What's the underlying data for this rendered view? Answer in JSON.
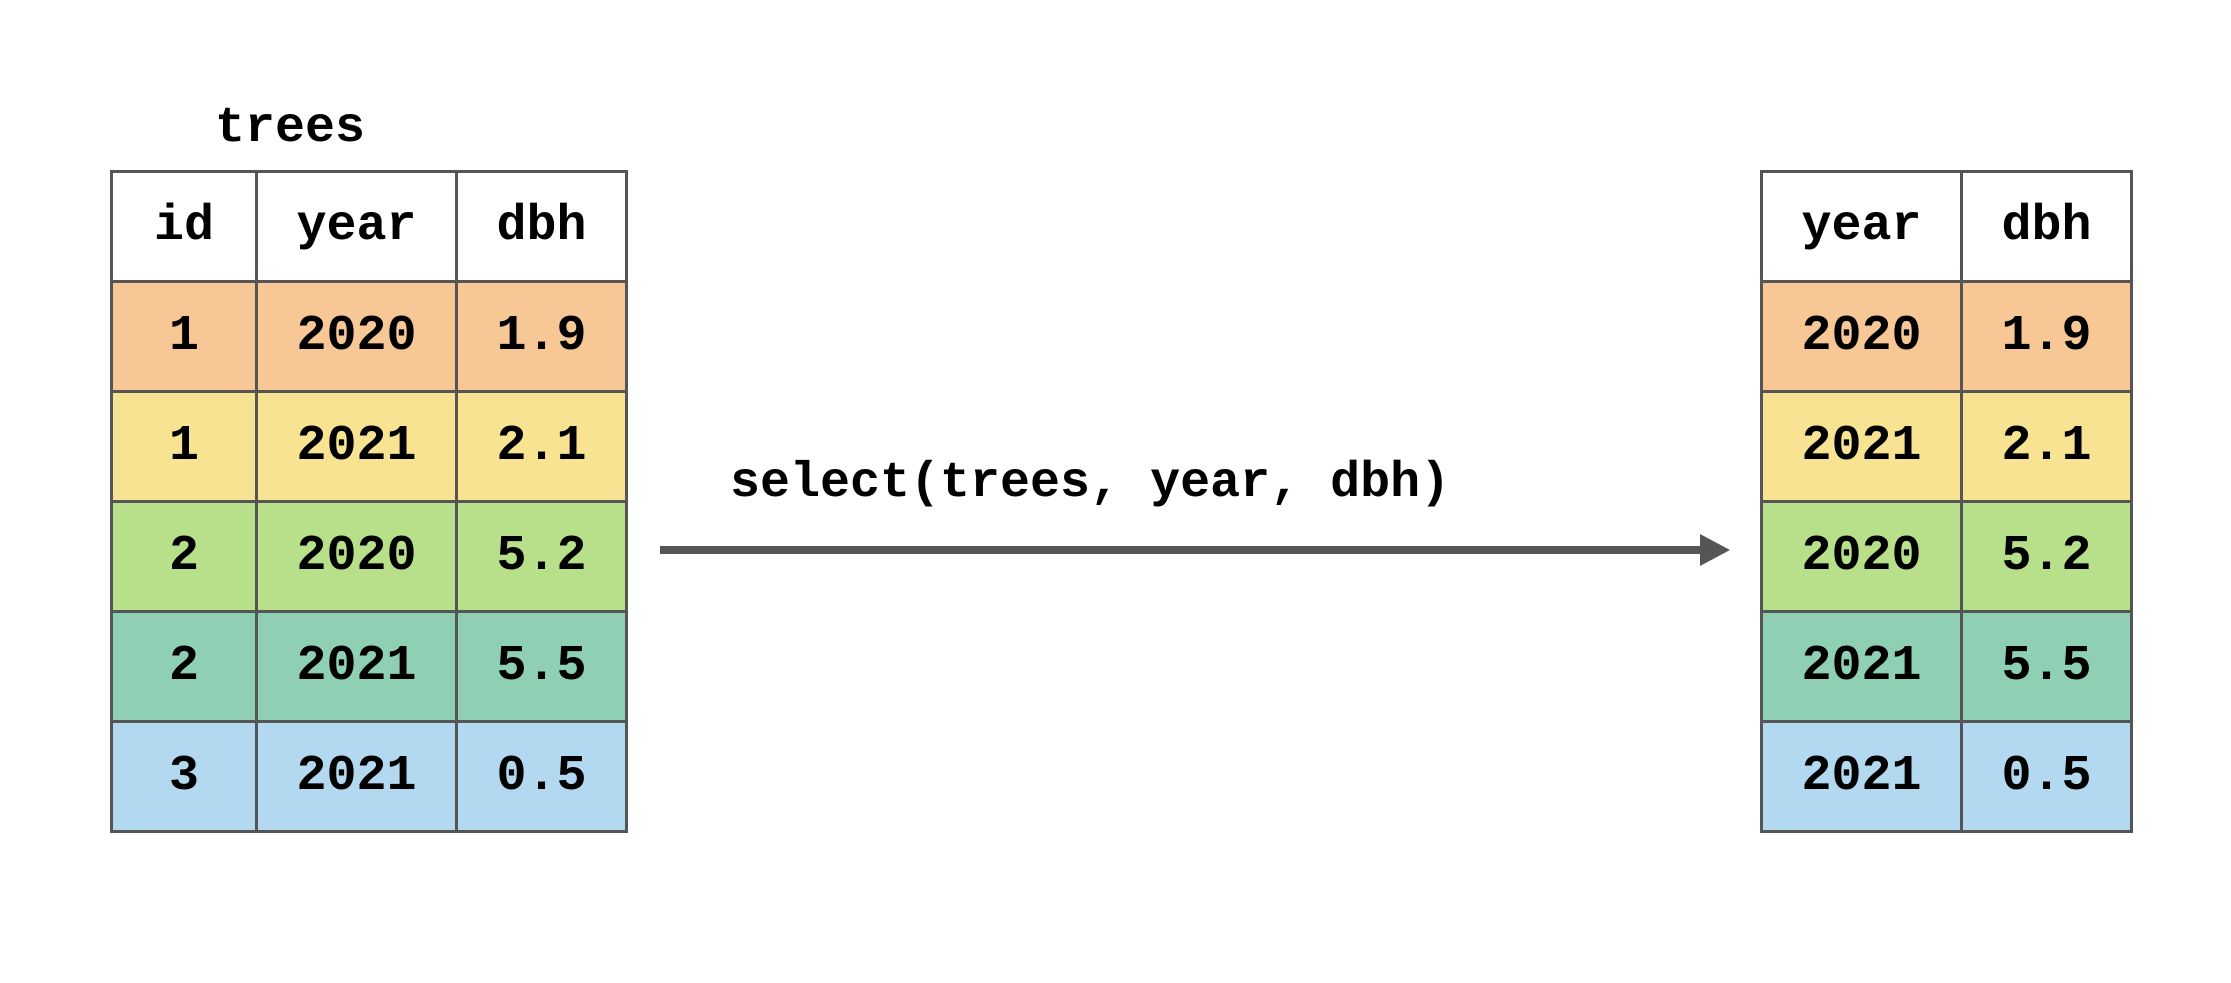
{
  "left_table": {
    "title": "trees",
    "headers": [
      "id",
      "year",
      "dbh"
    ],
    "rows": [
      {
        "color": "orange",
        "cells": [
          "1",
          "2020",
          "1.9"
        ]
      },
      {
        "color": "yellow",
        "cells": [
          "1",
          "2021",
          "2.1"
        ]
      },
      {
        "color": "green",
        "cells": [
          "2",
          "2020",
          "5.2"
        ]
      },
      {
        "color": "teal",
        "cells": [
          "2",
          "2021",
          "5.5"
        ]
      },
      {
        "color": "blue",
        "cells": [
          "3",
          "2021",
          "0.5"
        ]
      }
    ]
  },
  "operation_code": "select(trees, year, dbh)",
  "right_table": {
    "headers": [
      "year",
      "dbh"
    ],
    "rows": [
      {
        "color": "orange",
        "cells": [
          "2020",
          "1.9"
        ]
      },
      {
        "color": "yellow",
        "cells": [
          "2021",
          "2.1"
        ]
      },
      {
        "color": "green",
        "cells": [
          "2020",
          "5.2"
        ]
      },
      {
        "color": "teal",
        "cells": [
          "2021",
          "5.5"
        ]
      },
      {
        "color": "blue",
        "cells": [
          "2021",
          "0.5"
        ]
      }
    ]
  },
  "chart_data": {
    "type": "table",
    "title": "select(trees, year, dbh)",
    "input": {
      "name": "trees",
      "columns": [
        "id",
        "year",
        "dbh"
      ],
      "data": [
        [
          1,
          2020,
          1.9
        ],
        [
          1,
          2021,
          2.1
        ],
        [
          2,
          2020,
          5.2
        ],
        [
          2,
          2021,
          5.5
        ],
        [
          3,
          2021,
          0.5
        ]
      ]
    },
    "output": {
      "columns": [
        "year",
        "dbh"
      ],
      "data": [
        [
          2020,
          1.9
        ],
        [
          2021,
          2.1
        ],
        [
          2020,
          5.2
        ],
        [
          2021,
          5.5
        ],
        [
          2021,
          0.5
        ]
      ]
    }
  }
}
